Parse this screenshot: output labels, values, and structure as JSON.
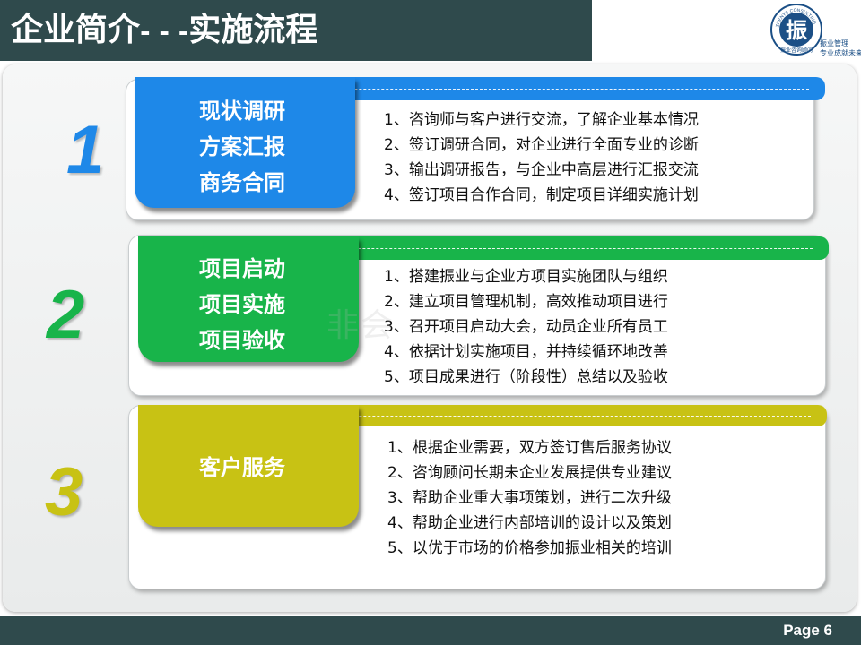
{
  "header": {
    "title_main": "企业简介",
    "title_sep": "- - -",
    "title_sub": "实施流程",
    "logo": {
      "glyph": "振",
      "ring_text": "ZHENYE CONSULTING",
      "bottom_text": "振业咨询顾问",
      "tagline_1": "振业管理",
      "tagline_2": "专业成就未来",
      "accent": "#1b4f86"
    }
  },
  "steps": [
    {
      "number": "1",
      "color": "#1e88e8",
      "tab_lines": [
        "现状调研",
        "方案汇报",
        "商务合同"
      ],
      "items": [
        "1、咨询师与客户进行交流，了解企业基本情况",
        "2、签订调研合同，对企业进行全面专业的诊断",
        "3、输出调研报告，与企业中高层进行汇报交流",
        "4、签订项目合作合同，制定项目详细实施计划"
      ]
    },
    {
      "number": "2",
      "color": "#18b44a",
      "tab_lines": [
        "项目启动",
        "项目实施",
        "项目验收"
      ],
      "items": [
        "1、搭建振业与企业方项目实施团队与组织",
        "2、建立项目管理机制，高效推动项目进行",
        "3、召开项目启动大会，动员企业所有员工",
        "4、依据计划实施项目，并持续循环地改善",
        "5、项目成果进行（阶段性）总结以及验收"
      ]
    },
    {
      "number": "3",
      "color": "#c8c214",
      "tab_lines": [
        "客户服务"
      ],
      "items": [
        "1、根据企业需要，双方签订售后服务协议",
        "2、咨询顾问长期未企业发展提供专业建议",
        "3、帮助企业重大事项策划，进行二次升级",
        "4、帮助企业进行内部培训的设计以及策划",
        "5、以优于市场的价格参加振业相关的培训"
      ]
    }
  ],
  "watermark": "非会",
  "footer": {
    "page": "Page 6"
  },
  "colors": {
    "title_bar": "#2f4a4c",
    "footer_bar": "#2f4a4c"
  }
}
